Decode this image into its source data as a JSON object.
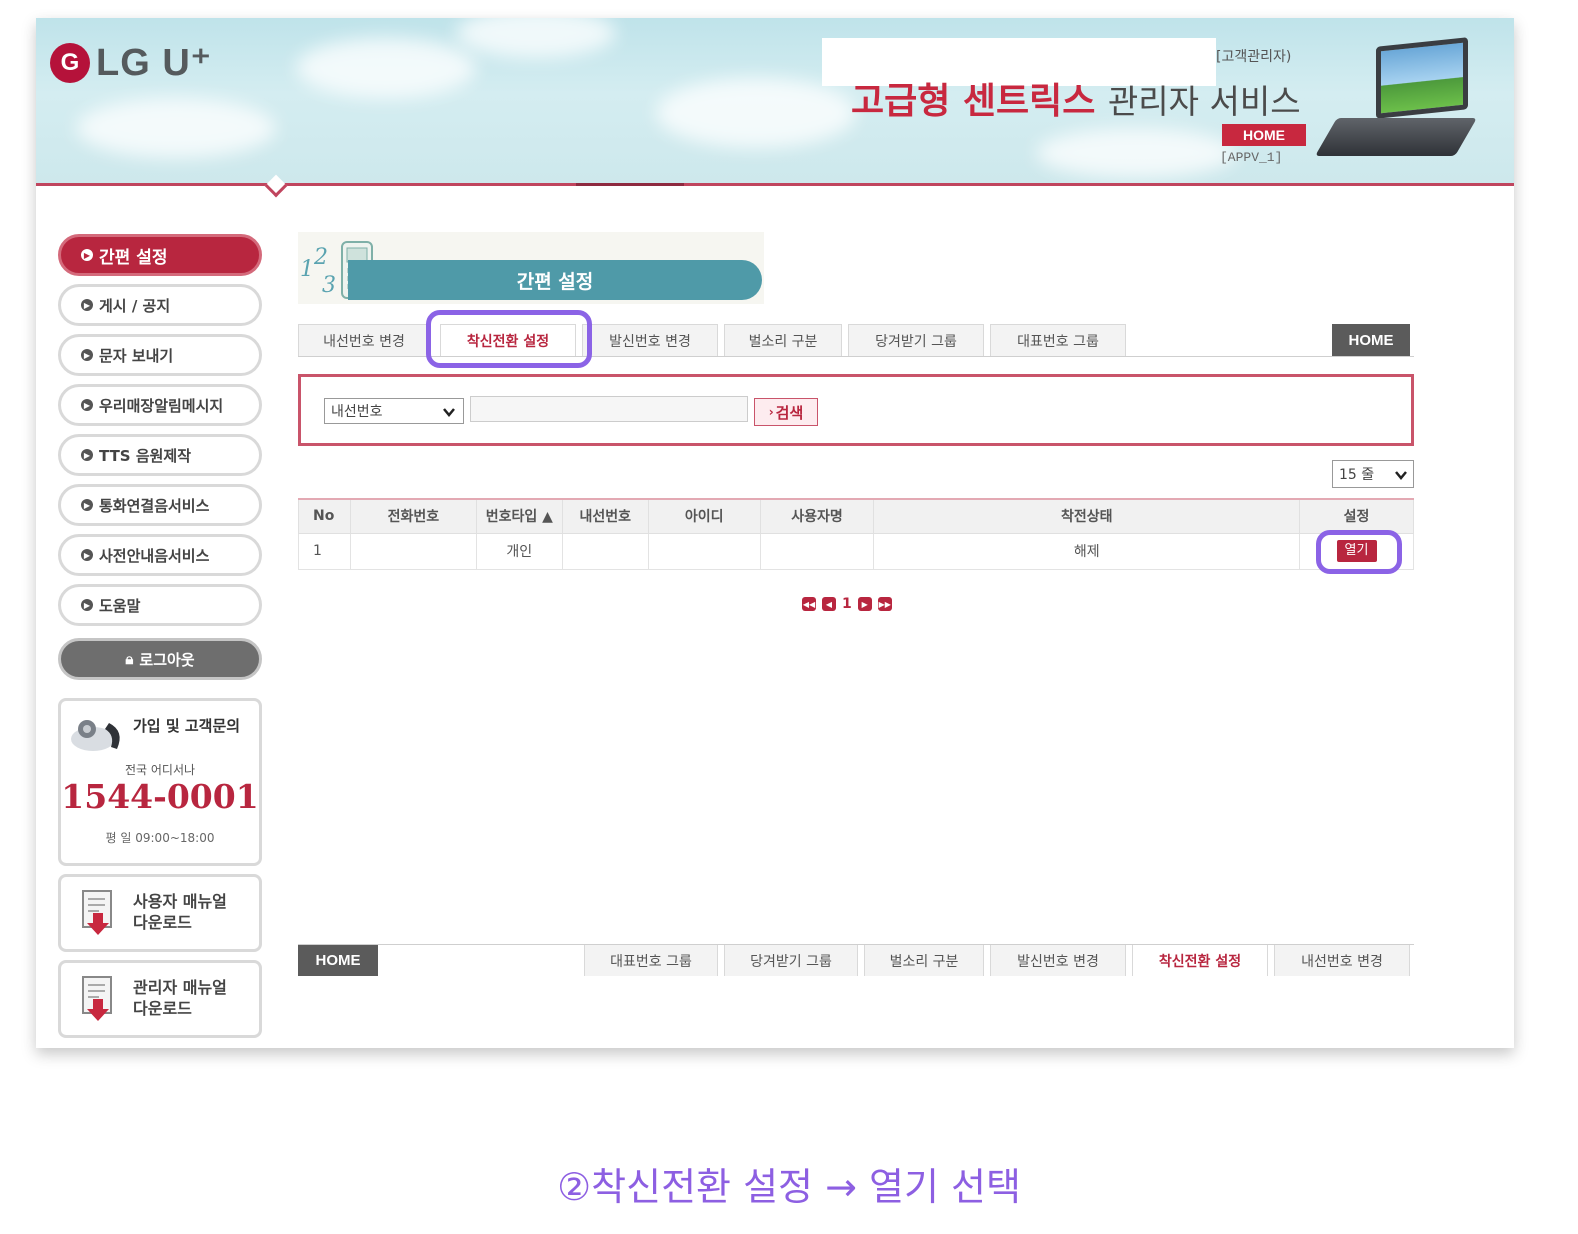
{
  "header": {
    "logo_letter": "G",
    "logo_text": "LG U⁺",
    "admin_role": "[고객관리자)",
    "service_title_em": "고급형 센트릭스",
    "service_title_rest": "관리자 서비스",
    "home_label": "HOME",
    "server_code": "[APPV_1]",
    "laptop_icon": "laptop-icon"
  },
  "sidebar": {
    "items": [
      {
        "label": "간편 설정",
        "active": true
      },
      {
        "label": "게시 / 공지"
      },
      {
        "label": "문자 보내기"
      },
      {
        "label": "우리매장알림메시지"
      },
      {
        "label": "TTS 음원제작"
      },
      {
        "label": "통화연결음서비스"
      },
      {
        "label": "사전안내음서비스"
      },
      {
        "label": "도움말"
      }
    ],
    "logout_label": "로그아웃",
    "contact": {
      "title": "가입 및 고객문의",
      "sub": "전국 어디서나",
      "phone": "1544-0001",
      "hours": "평 일 09:00~18:00"
    },
    "user_manual": {
      "line1": "사용자 매뉴얼",
      "line2": "다운로드"
    },
    "admin_manual": {
      "line1": "관리자 매뉴얼",
      "line2": "다운로드"
    }
  },
  "main": {
    "page_title": "간편 설정",
    "tabs": [
      {
        "label": "내선번호 변경"
      },
      {
        "label": "착신전환 설정",
        "active": true
      },
      {
        "label": "발신번호 변경"
      },
      {
        "label": "벌소리 구분"
      },
      {
        "label": "당겨받기 그룹"
      },
      {
        "label": "대표번호 그룹"
      }
    ],
    "home_label": "HOME",
    "search": {
      "field_selected": "내선번호",
      "value": "",
      "button_label": "검색"
    },
    "page_size": "15 줄",
    "table": {
      "headers": [
        "No",
        "전화번호",
        "번호타입 ▲",
        "내선번호",
        "아이디",
        "사용자명",
        "착전상태",
        "설정"
      ],
      "rows": [
        {
          "no": "1",
          "phone": "",
          "type": "개인",
          "ext": "",
          "id": "",
          "user": "",
          "status": "해제",
          "action": "열기"
        }
      ]
    },
    "pager": {
      "current": "1"
    },
    "bottom_tabs": [
      {
        "label": "대표번호 그룹"
      },
      {
        "label": "당겨받기 그룹"
      },
      {
        "label": "벌소리 구분"
      },
      {
        "label": "발신번호 변경"
      },
      {
        "label": "착신전환 설정",
        "active": true
      },
      {
        "label": "내선번호 변경"
      }
    ]
  },
  "caption": "②착신전환 설정 → 열기 선택",
  "colors": {
    "accent": "#b8263f",
    "teal": "#4f9aa8",
    "highlight": "#8b63e6"
  }
}
